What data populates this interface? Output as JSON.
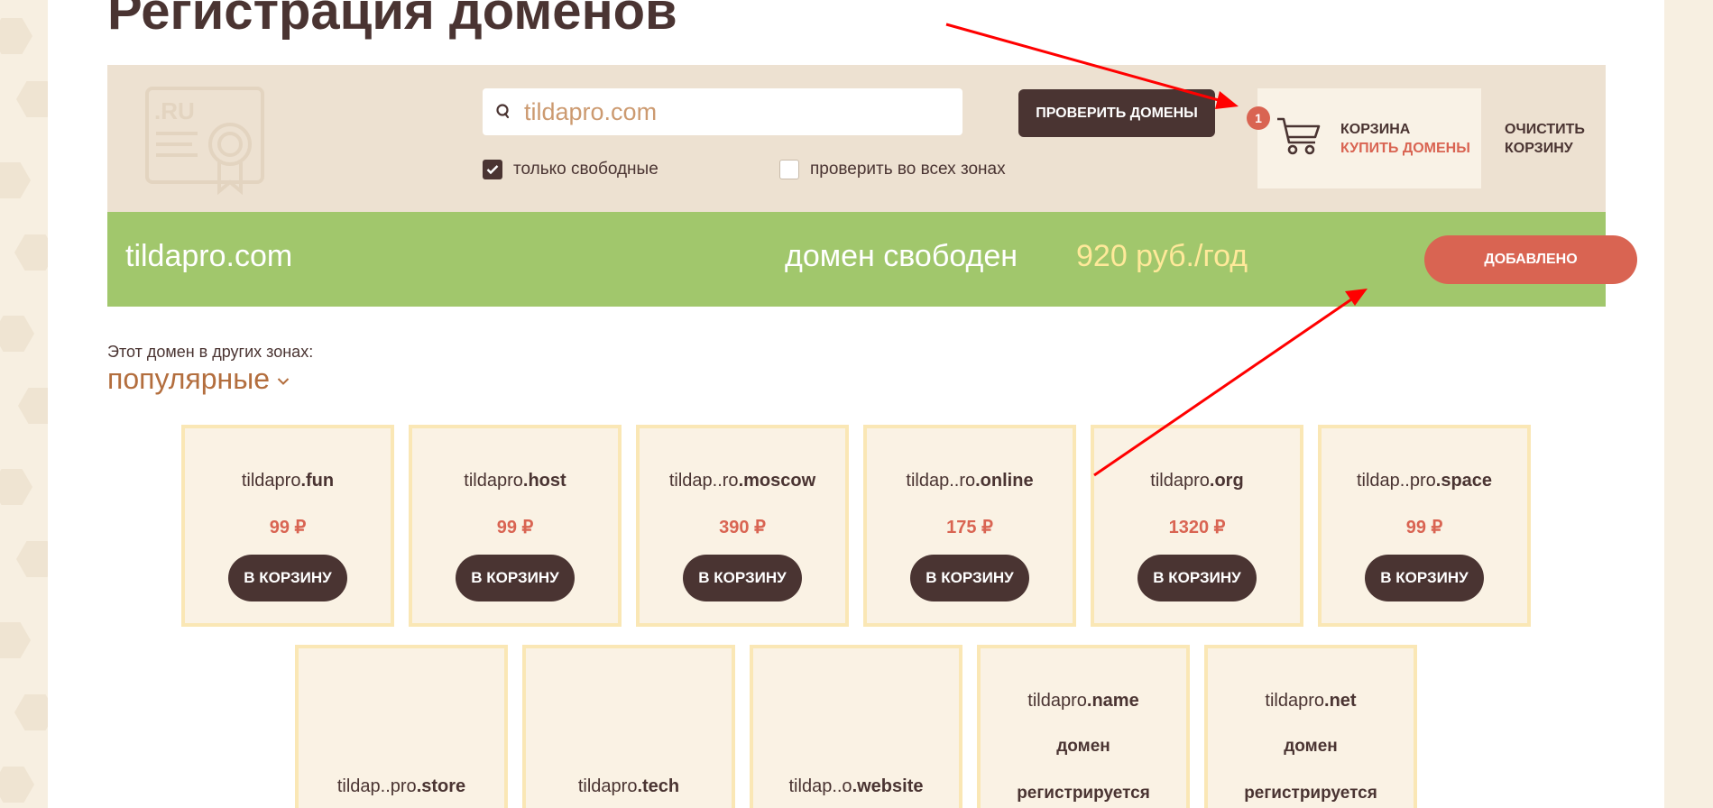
{
  "page": {
    "title": "Регистрация доменов"
  },
  "search": {
    "value": "tildapro.com",
    "check_button": "ПРОВЕРИТЬ ДОМЕНЫ",
    "only_free_label": "только свободные",
    "only_free_checked": true,
    "all_zones_label": "проверить во всех зонах",
    "all_zones_checked": false,
    "icon": "search-icon"
  },
  "cart": {
    "count": "1",
    "title": "КОРЗИНА",
    "buy_label": "КУПИТЬ ДОМЕНЫ",
    "clear_label": "ОЧИСТИТЬ КОРЗИНУ",
    "icon": "cart-icon"
  },
  "result": {
    "domain": "tildapro.com",
    "status": "домен свободен",
    "price": "920 руб./год",
    "button": "ДОБАВЛЕНО"
  },
  "other_zones": {
    "label": "Этот домен в других зонах:",
    "selected": "популярные"
  },
  "cards_row1": [
    {
      "base": "tildapro",
      "zone": ".fun",
      "price": "99 ₽",
      "button": "В КОРЗИНУ"
    },
    {
      "base": "tildapro",
      "zone": ".host",
      "price": "99 ₽",
      "button": "В КОРЗИНУ"
    },
    {
      "base": "tildap..ro",
      "zone": ".moscow",
      "price": "390 ₽",
      "button": "В КОРЗИНУ"
    },
    {
      "base": "tildap..ro",
      "zone": ".online",
      "price": "175 ₽",
      "button": "В КОРЗИНУ"
    },
    {
      "base": "tildapro",
      "zone": ".org",
      "price": "1320 ₽",
      "button": "В КОРЗИНУ"
    },
    {
      "base": "tildap..pro",
      "zone": ".space",
      "price": "99 ₽",
      "button": "В КОРЗИНУ"
    }
  ],
  "cards_row2": [
    {
      "base": "tildap..pro",
      "zone": ".store"
    },
    {
      "base": "tildapro",
      "zone": ".tech"
    },
    {
      "base": "tildap..o",
      "zone": ".website"
    },
    {
      "base": "tildapro",
      "zone": ".name",
      "status1": "домен",
      "status2": "регистрируется"
    },
    {
      "base": "tildapro",
      "zone": ".net",
      "status1": "домен",
      "status2": "регистрируется"
    }
  ],
  "colors": {
    "brown": "#4a3432",
    "coral": "#d96452",
    "green": "#a1c76c",
    "panel": "#ede1d1",
    "card_border": "#fae7b5",
    "arrow": "#ff0000"
  }
}
